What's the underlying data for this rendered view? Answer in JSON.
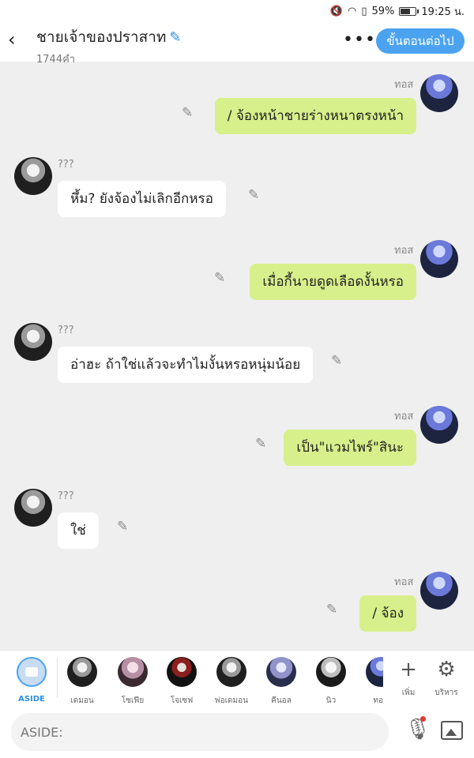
{
  "status_bar": {
    "battery": "59%",
    "time": "19:25 น.",
    "battery_level": 0.59
  },
  "header": {
    "title": "ชายเจ้าของปราสาท",
    "word_count": "1744คำ",
    "next_button": "ขั้นตอนต่อไป",
    "icons": [
      "back-icon",
      "pencil-icon",
      "more-icon"
    ]
  },
  "messages": [
    {
      "speaker": "ทอส",
      "side": "right",
      "text": "/ จ้องหน้าชายร่างหนาตรงหน้า"
    },
    {
      "speaker": "???",
      "side": "left",
      "text": "หึ้ม? ยังจ้องไม่เลิกอีกหรอ"
    },
    {
      "speaker": "ทอส",
      "side": "right",
      "text": "เมื่อกี้นายดูดเลือดงั้นหรอ"
    },
    {
      "speaker": "???",
      "side": "left",
      "text": "อ่าฮะ ถ้าใช่แล้วจะทำไมงั้นหรอหนุ่มน้อย"
    },
    {
      "speaker": "ทอส",
      "side": "right",
      "text": "เป็น\"แวมไพร์\"สินะ"
    },
    {
      "speaker": "???",
      "side": "left",
      "text": "ใช่"
    },
    {
      "speaker": "ทอส",
      "side": "right",
      "text": "/ จ้อง"
    }
  ],
  "character_bar": {
    "aside_label": "ASIDE",
    "characters": [
      "เดมอน",
      "โซเฟีย",
      "โจเซฟ",
      "พ่อเดมอน",
      "คีนอล",
      "นิว",
      "ทอ"
    ],
    "add_label": "เพิ่ม",
    "manage_label": "บริหาร"
  },
  "input_bar": {
    "placeholder": "ASIDE:"
  },
  "colors": {
    "accent": "#4ba3f0",
    "my_bubble": "#d7f08b",
    "their_bubble": "#ffffff",
    "background": "#efefef"
  }
}
